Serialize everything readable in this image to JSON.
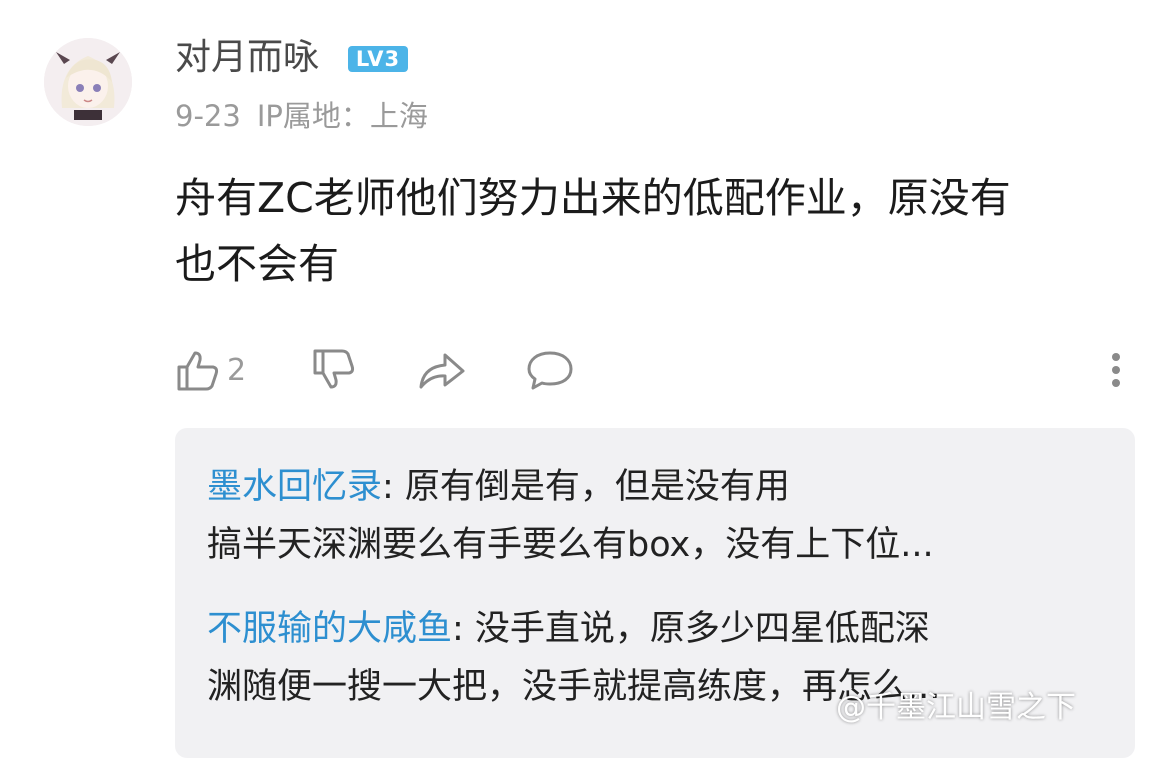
{
  "comment": {
    "username": "对月而咏",
    "level": "LV3",
    "date": "9-23",
    "ip_location": "IP属地：上海",
    "text_line1": "舟有ZC老师他们努力出来的低配作业，原没有",
    "text_line2": "也不会有",
    "like_count": "2"
  },
  "replies": [
    {
      "author": "墨水回忆录",
      "line1": ": 原有倒是有，但是没有用",
      "line2": "搞半天深渊要么有手要么有box，没有上下位..."
    },
    {
      "author": "不服输的大咸鱼",
      "line1": ": 没手直说，原多少四星低配深",
      "line2": "渊随便一搜一大把，没手就提高练度，再怎么..."
    }
  ],
  "watermark": "@千墨江山雪之下"
}
